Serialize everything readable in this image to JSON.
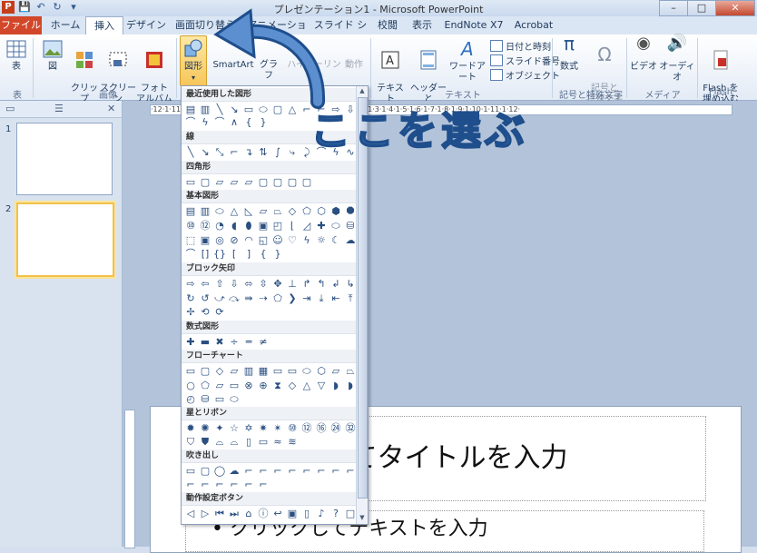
{
  "window": {
    "title": "プレゼンテーション1 - Microsoft PowerPoint",
    "app_icon": "P",
    "minimize": "–",
    "maximize": "□",
    "close": "✕"
  },
  "tabs": [
    {
      "label": "ファイル"
    },
    {
      "label": "ホーム"
    },
    {
      "label": "挿入"
    },
    {
      "label": "デザイン"
    },
    {
      "label": "画面切り替え"
    },
    {
      "label": "アニメーション"
    },
    {
      "label": "スライド ショー"
    },
    {
      "label": "校閲"
    },
    {
      "label": "表示"
    },
    {
      "label": "EndNote X7"
    },
    {
      "label": "Acrobat"
    }
  ],
  "ribbon": {
    "table": "表",
    "table_group": "表",
    "picture": "図",
    "clipart": "クリップ\nアート",
    "screenshot": "スクリーン\nショット",
    "photoalbum": "フォト\nアルバム",
    "images_group": "画像",
    "shapes": "図形",
    "smartart": "SmartArt",
    "chart": "グラフ",
    "hyperlink": "ハイパーリンク",
    "action": "動作",
    "textbox": "テキスト\nボックス",
    "headerfooter": "ヘッダーと\nフッター",
    "wordart": "ワードアート",
    "datetime": "日付と時刻",
    "slidenumber": "スライド番号",
    "object": "オブジェクト",
    "text_group": "テキスト",
    "equation": "数式",
    "symbol": "記号と\n特殊文字",
    "symbols_group": "記号と特殊文字",
    "video": "ビデオ",
    "audio": "オーディオ",
    "media_group": "メディア",
    "flash": "Flash を\n埋め込む",
    "flash_group": "Flash"
  },
  "gallery": {
    "categories": [
      "最近使用した図形",
      "線",
      "四角形",
      "基本図形",
      "ブロック矢印",
      "数式図形",
      "フローチャート",
      "星とリボン",
      "吹き出し",
      "動作設定ボタン"
    ]
  },
  "slides_panel": {
    "slide1": "1",
    "slide2": "2"
  },
  "slide": {
    "title_placeholder": "してタイトルを入力",
    "body_placeholder": "• クリックしてテキストを入力"
  },
  "annotation": {
    "text": "ここを選ぶ"
  },
  "colors": {
    "file_tab": "#d2472a",
    "annotation": "#5b8fd0",
    "highlight": "#f7c65a"
  }
}
